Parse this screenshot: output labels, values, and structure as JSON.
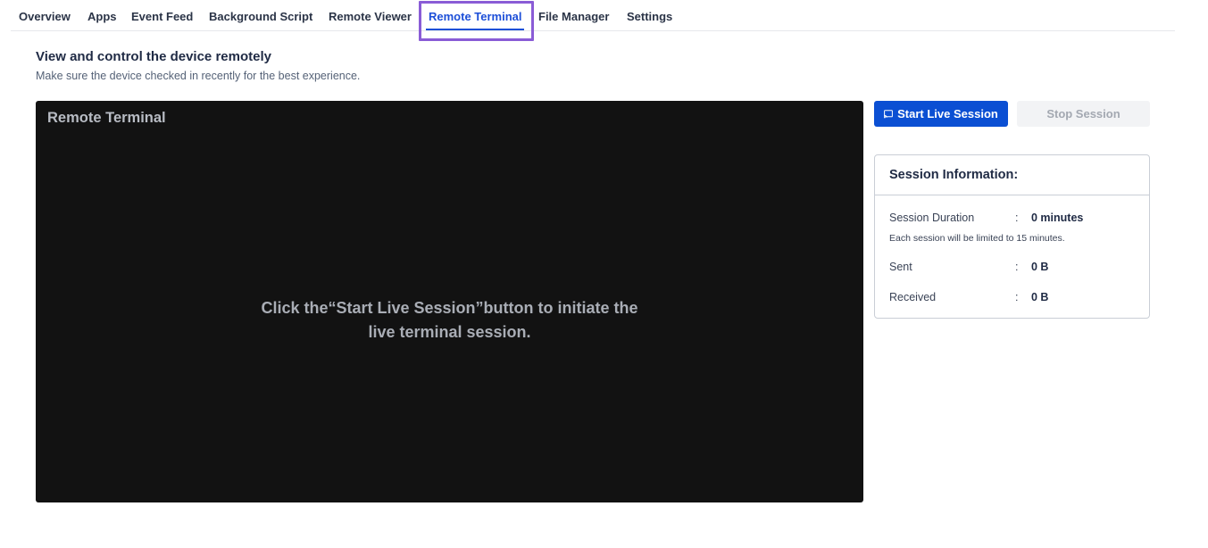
{
  "tabs": [
    {
      "label": "Overview"
    },
    {
      "label": "Apps"
    },
    {
      "label": "Event Feed"
    },
    {
      "label": "Background Script"
    },
    {
      "label": "Remote Viewer"
    },
    {
      "label": "Remote Terminal"
    },
    {
      "label": "File Manager"
    },
    {
      "label": "Settings"
    }
  ],
  "active_tab": "Remote Terminal",
  "header": {
    "title": "View and control the device remotely",
    "subtitle": "Make sure the device checked in recently for the best experience."
  },
  "terminal": {
    "title": "Remote Terminal",
    "message_line1": "Click the“Start Live Session”button to initiate the",
    "message_line2": "live terminal session."
  },
  "controls": {
    "start_label": "Start Live Session",
    "start_icon": "cast-icon",
    "stop_label": "Stop Session"
  },
  "session_info": {
    "title": "Session Information:",
    "duration_label": "Session Duration",
    "duration_value": "0 minutes",
    "duration_note": "Each session will be limited to 15 minutes.",
    "sent_label": "Sent",
    "sent_value": "0 B",
    "received_label": "Received",
    "received_value": "0 B",
    "separator": ":"
  },
  "colors": {
    "accent": "#1d4fd8",
    "primary_button": "#0b4fd3",
    "terminal_bg": "#121212",
    "highlight": "#8a5cd6"
  }
}
